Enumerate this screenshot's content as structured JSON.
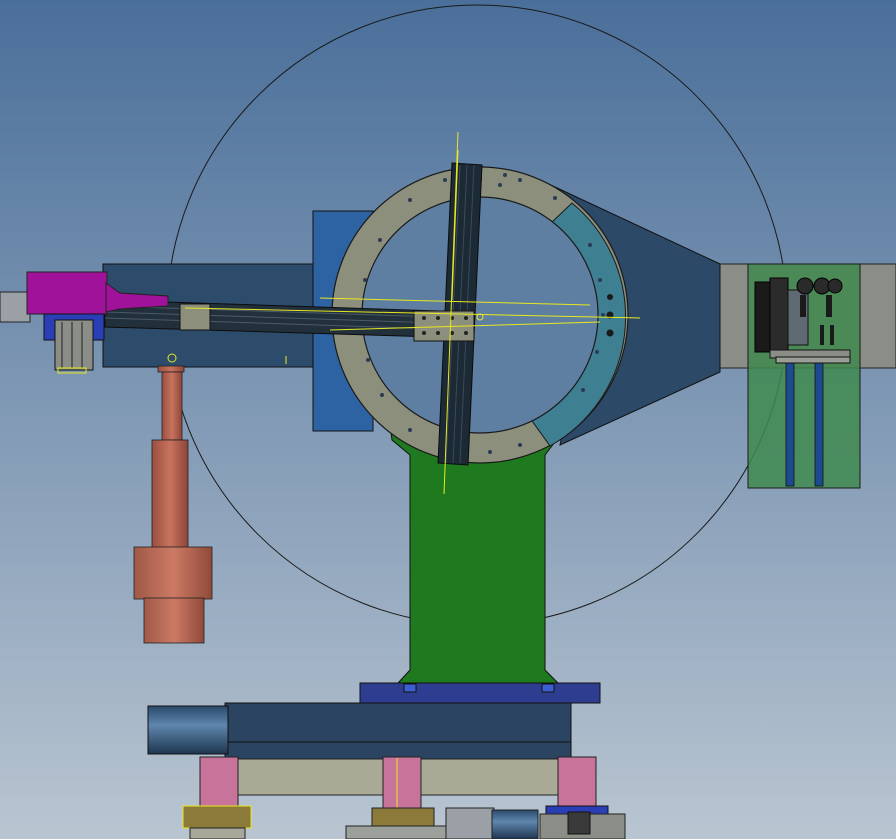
{
  "colors": {
    "bg_top": "#4a6f9a",
    "bg_bottom": "#b7c3cf",
    "ring": "#8c8f7c",
    "ring_arc": "#3f7f92",
    "cross_beam": "#1c2a36",
    "green_pedestal": "#1f7a1f",
    "blue_block": "#2e63a3",
    "dark_blue_plate": "#2b4461",
    "magenta_motor": "#a0129a",
    "copper_column": "#b3614f",
    "pink_support": "#c7739a",
    "gray_housing": "#8a8e86",
    "green_panel": "#3f8a4f",
    "yellow_line": "#e8e820"
  },
  "parts": {
    "large_circle": "orbit-circle",
    "ring": "rotary-ring",
    "cross": "cross-beam",
    "arm": "horizontal-arm",
    "motor": "drive-motor",
    "column": "copper-column",
    "pedestal": "green-pedestal",
    "base": "base-assembly",
    "right_housing": "right-housing",
    "right_panel": "right-panel"
  }
}
